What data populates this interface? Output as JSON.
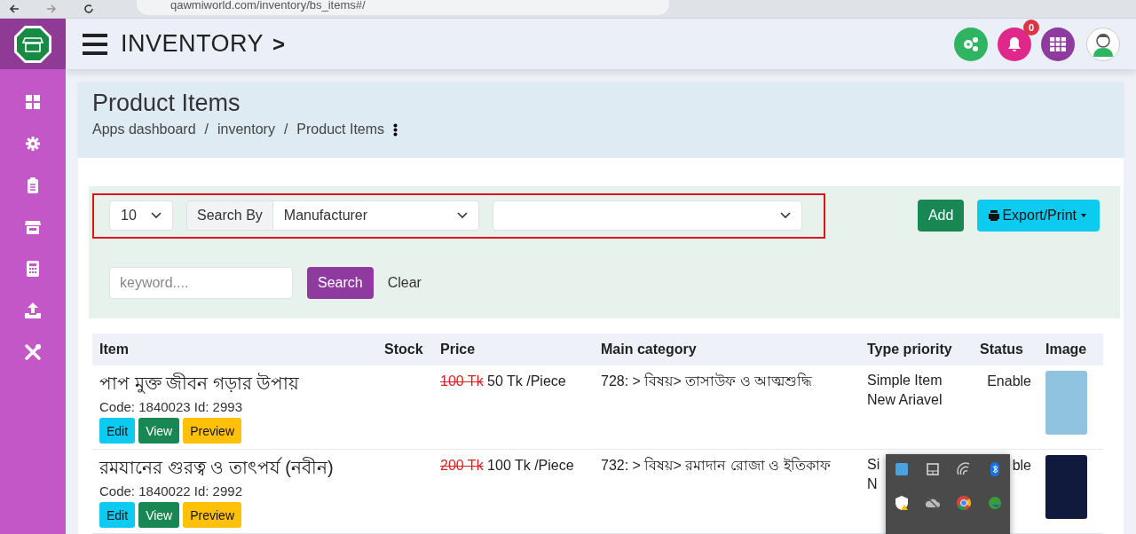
{
  "browser": {
    "url": "qawmiworld.com/inventory/bs_items#/"
  },
  "header": {
    "title": "INVENTORY",
    "chevron": ">",
    "notification_count": "0"
  },
  "page": {
    "title": "Product Items",
    "breadcrumb": [
      "Apps dashboard",
      "inventory",
      "Product Items"
    ],
    "separator": "/"
  },
  "filters": {
    "page_size": "10",
    "search_by_label": "Search By",
    "search_by": "Manufacturer",
    "keyword_placeholder": "keyword....",
    "search_button": "Search",
    "clear_button": "Clear",
    "add_button": "Add",
    "export_button": "Export/Print"
  },
  "table": {
    "columns": [
      "Item",
      "Stock",
      "Price",
      "Main category",
      "Type priority",
      "Status",
      "Image"
    ],
    "rows": [
      {
        "item": "পাপ মুক্ত জীবন গড়ার উপায়",
        "code": "Code: 1840023 Id: 2993",
        "actions": [
          "Edit",
          "View",
          "Preview"
        ],
        "old_price": "100 Tk",
        "price": "50 Tk /Piece",
        "main_category": "728: > বিষয়> তাসাউফ ও আত্মশুদ্ধি",
        "type_priority": [
          "Simple Item",
          "New Ariavel"
        ],
        "status": "Enable",
        "color": "#8fc3e0"
      },
      {
        "item": "রমযানের গুরত্ব ও তাৎপর্য (নবীন)",
        "code": "Code: 1840022 Id: 2992",
        "actions": [
          "Edit",
          "View",
          "Preview"
        ],
        "old_price": "200 Tk",
        "price": "100 Tk /Piece",
        "main_category": "732: > বিষয়> রমাদান রোজা ও ইতিকাফ",
        "type_priority": [
          "Si",
          "N"
        ],
        "status": "ble",
        "color": "#101a3c"
      }
    ]
  }
}
